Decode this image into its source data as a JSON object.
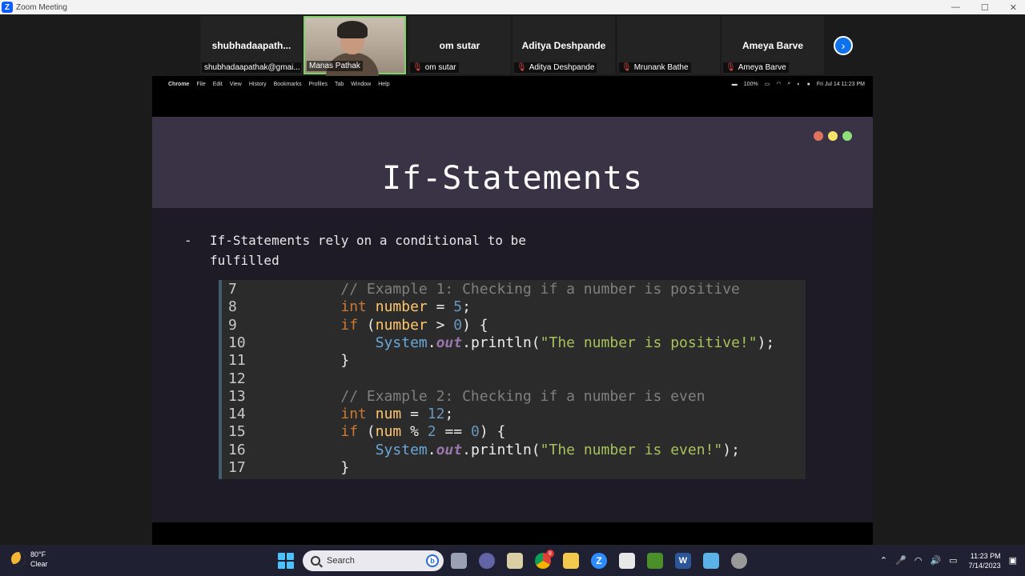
{
  "window": {
    "title": "Zoom Meeting",
    "minimize": "—",
    "maximize": "☐",
    "close": "✕"
  },
  "participants": [
    {
      "big_name": "shubhadaapath...",
      "label": "shubhadaapathak@gmai...",
      "muted": false
    },
    {
      "big_name": "",
      "label": "Manas Pathak",
      "muted": false,
      "video": true
    },
    {
      "big_name": "om sutar",
      "label": "om sutar",
      "muted": true
    },
    {
      "big_name": "Aditya Deshpande",
      "label": "Aditya Deshpande",
      "muted": true
    },
    {
      "big_name": "",
      "label": "Mrunank Bathe",
      "muted": true
    },
    {
      "big_name": "Ameya Barve",
      "label": "Ameya Barve",
      "muted": true
    }
  ],
  "mac_menubar": {
    "app": "Chrome",
    "menus": [
      "File",
      "Edit",
      "View",
      "History",
      "Bookmarks",
      "Profiles",
      "Tab",
      "Window",
      "Help"
    ],
    "battery": "100%",
    "datetime": "Fri Jul 14  11:23 PM"
  },
  "slide": {
    "title": "If-Statements",
    "bullet_dash": "-",
    "bullet_text": "If-Statements rely on a conditional to be fulfilled",
    "window_dot_colors": [
      "#e0735f",
      "#f5e36a",
      "#8fe07a"
    ]
  },
  "code": {
    "lines": [
      {
        "n": "7",
        "tokens": [
          [
            "t-plain",
            "          "
          ],
          [
            "t-comment",
            "// Example 1: Checking if a number is positive"
          ]
        ]
      },
      {
        "n": "8",
        "tokens": [
          [
            "t-plain",
            "          "
          ],
          [
            "t-kw",
            "int "
          ],
          [
            "t-var",
            "number"
          ],
          [
            "t-plain",
            " = "
          ],
          [
            "t-num",
            "5"
          ],
          [
            "t-plain",
            ";"
          ]
        ]
      },
      {
        "n": "9",
        "tokens": [
          [
            "t-plain",
            "          "
          ],
          [
            "t-kw",
            "if "
          ],
          [
            "t-plain",
            "("
          ],
          [
            "t-var",
            "number"
          ],
          [
            "t-plain",
            " > "
          ],
          [
            "t-num",
            "0"
          ],
          [
            "t-plain",
            ") {"
          ]
        ]
      },
      {
        "n": "10",
        "tokens": [
          [
            "t-plain",
            "              "
          ],
          [
            "t-sys",
            "System"
          ],
          [
            "t-plain",
            "."
          ],
          [
            "t-out",
            "out"
          ],
          [
            "t-plain",
            ".println("
          ],
          [
            "t-str",
            "\"The number is positive!\""
          ],
          [
            "t-plain",
            ");"
          ]
        ]
      },
      {
        "n": "11",
        "tokens": [
          [
            "t-plain",
            "          }"
          ]
        ]
      },
      {
        "n": "12",
        "tokens": []
      },
      {
        "n": "13",
        "tokens": [
          [
            "t-plain",
            "          "
          ],
          [
            "t-comment",
            "// Example 2: Checking if a number is even"
          ]
        ]
      },
      {
        "n": "14",
        "tokens": [
          [
            "t-plain",
            "          "
          ],
          [
            "t-kw",
            "int "
          ],
          [
            "t-var",
            "num"
          ],
          [
            "t-plain",
            " = "
          ],
          [
            "t-num",
            "12"
          ],
          [
            "t-plain",
            ";"
          ]
        ]
      },
      {
        "n": "15",
        "tokens": [
          [
            "t-plain",
            "          "
          ],
          [
            "t-kw",
            "if "
          ],
          [
            "t-plain",
            "("
          ],
          [
            "t-var",
            "num"
          ],
          [
            "t-plain",
            " % "
          ],
          [
            "t-num",
            "2"
          ],
          [
            "t-plain",
            " == "
          ],
          [
            "t-num",
            "0"
          ],
          [
            "t-plain",
            ") {"
          ]
        ]
      },
      {
        "n": "16",
        "tokens": [
          [
            "t-plain",
            "              "
          ],
          [
            "t-sys",
            "System"
          ],
          [
            "t-plain",
            "."
          ],
          [
            "t-out",
            "out"
          ],
          [
            "t-plain",
            ".println("
          ],
          [
            "t-str",
            "\"The number is even!\""
          ],
          [
            "t-plain",
            ");"
          ]
        ]
      },
      {
        "n": "17",
        "tokens": [
          [
            "t-plain",
            "          }"
          ]
        ]
      }
    ]
  },
  "taskbar": {
    "weather_temp": "80°F",
    "weather_desc": "Clear",
    "search_placeholder": "Search",
    "time": "11:23 PM",
    "date": "7/14/2023",
    "icons": [
      "start-icon",
      "search-icon",
      "task-view-icon",
      "meet-icon",
      "file-explorer-icon",
      "chrome-icon",
      "files-icon",
      "zoom-icon",
      "snipping-icon",
      "minecraft-icon",
      "word-icon",
      "notepad-icon",
      "settings-icon"
    ],
    "chrome_badge": "8"
  }
}
